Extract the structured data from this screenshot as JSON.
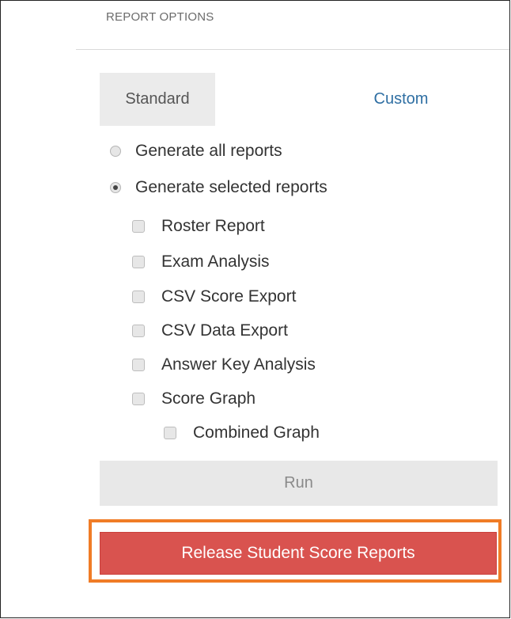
{
  "section": {
    "title": "REPORT OPTIONS"
  },
  "tabs": {
    "standard": "Standard",
    "custom": "Custom"
  },
  "generate": {
    "all_label": "Generate all reports",
    "all_selected": false,
    "selected_label": "Generate selected reports",
    "selected_selected": true
  },
  "reports": [
    {
      "label": "Roster Report",
      "checked": false
    },
    {
      "label": "Exam Analysis",
      "checked": false
    },
    {
      "label": "CSV Score Export",
      "checked": false
    },
    {
      "label": "CSV Data Export",
      "checked": false
    },
    {
      "label": "Answer Key Analysis",
      "checked": false
    },
    {
      "label": "Score Graph",
      "checked": false
    }
  ],
  "sub_reports": [
    {
      "label": "Combined Graph",
      "checked": false
    }
  ],
  "actions": {
    "run_label": "Run",
    "release_label": "Release Student Score Reports"
  },
  "colors": {
    "release_button": "#d9534f",
    "highlight_outline": "#f07c26",
    "custom_tab_text": "#2f6fa3"
  }
}
